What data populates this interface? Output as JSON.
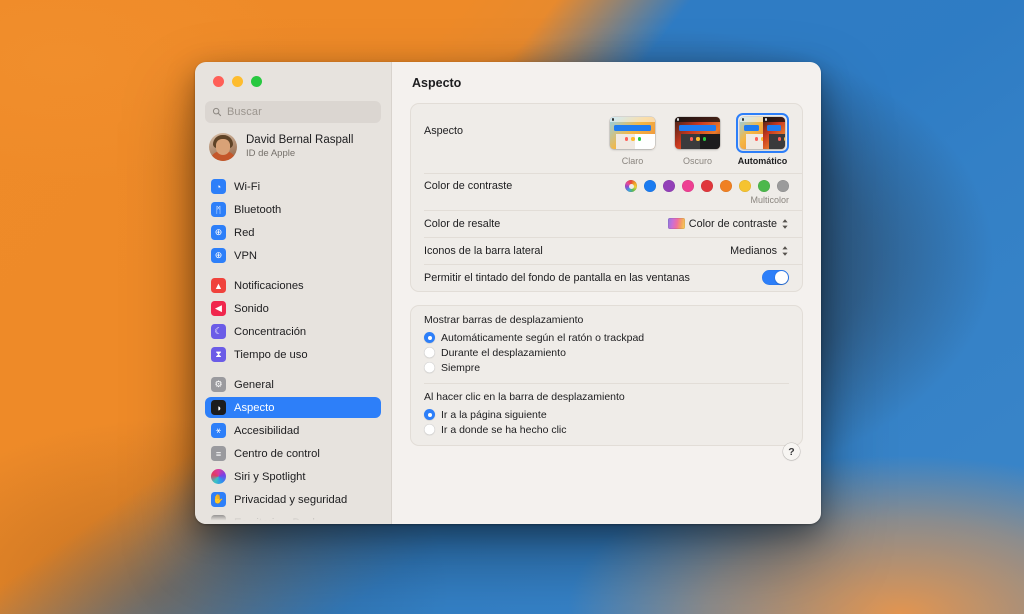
{
  "window": {
    "traffic_lights": [
      {
        "name": "close",
        "color": "#ff5f57"
      },
      {
        "name": "minimize",
        "color": "#febc2e"
      },
      {
        "name": "maximize",
        "color": "#28c840"
      }
    ]
  },
  "sidebar": {
    "search": {
      "placeholder": "Buscar",
      "value": ""
    },
    "profile": {
      "name": "David Bernal Raspall",
      "subtitle": "ID de Apple"
    },
    "groups": [
      {
        "items": [
          {
            "label": "Wi-Fi",
            "icon": "wifi-icon",
            "icon_bg": "#2d7ff9",
            "glyph": "◔",
            "selected": false
          },
          {
            "label": "Bluetooth",
            "icon": "bluetooth-icon",
            "icon_bg": "#2d7ff9",
            "glyph": "ᛗ",
            "selected": false
          },
          {
            "label": "Red",
            "icon": "network-icon",
            "icon_bg": "#2d7ff9",
            "glyph": "⊕",
            "selected": false
          },
          {
            "label": "VPN",
            "icon": "vpn-icon",
            "icon_bg": "#2d7ff9",
            "glyph": "⊕",
            "selected": false
          }
        ]
      },
      {
        "items": [
          {
            "label": "Notificaciones",
            "icon": "bell-icon",
            "icon_bg": "#f0423c",
            "glyph": "▲",
            "selected": false
          },
          {
            "label": "Sonido",
            "icon": "speaker-icon",
            "icon_bg": "#f0274d",
            "glyph": "◀",
            "selected": false
          },
          {
            "label": "Concentración",
            "icon": "moon-icon",
            "icon_bg": "#6b5ce7",
            "glyph": "☾",
            "selected": false
          },
          {
            "label": "Tiempo de uso",
            "icon": "hourglass-icon",
            "icon_bg": "#6b5ce7",
            "glyph": "⧗",
            "selected": false
          }
        ]
      },
      {
        "items": [
          {
            "label": "General",
            "icon": "gear-icon",
            "icon_bg": "#9a9a9e",
            "glyph": "⚙",
            "selected": false
          },
          {
            "label": "Aspecto",
            "icon": "appearance-icon",
            "icon_bg": "#1c1c1e",
            "glyph": "◑",
            "selected": true
          },
          {
            "label": "Accesibilidad",
            "icon": "accessibility-icon",
            "icon_bg": "#2d7ff9",
            "glyph": "⚹",
            "selected": false
          },
          {
            "label": "Centro de control",
            "icon": "control-center-icon",
            "icon_bg": "#9a9a9e",
            "glyph": "≡",
            "selected": false
          },
          {
            "label": "Siri y Spotlight",
            "icon": "siri-icon",
            "icon_bg": "#6b3fd4",
            "glyph": "",
            "selected": false
          },
          {
            "label": "Privacidad y seguridad",
            "icon": "privacy-hand-icon",
            "icon_bg": "#2d7ff9",
            "glyph": "✋",
            "selected": false
          },
          {
            "label": "Escritorio y Dock",
            "icon": "desktop-dock-icon",
            "icon_bg": "#2f2f33",
            "glyph": "▭",
            "selected": false
          }
        ]
      }
    ]
  },
  "main": {
    "title": "Aspecto",
    "appearance": {
      "label": "Aspecto",
      "options": [
        {
          "label": "Claro",
          "mode": "light",
          "selected": false
        },
        {
          "label": "Oscuro",
          "mode": "dark",
          "selected": false
        },
        {
          "label": "Automático",
          "mode": "auto",
          "selected": true
        }
      ]
    },
    "contrast_color": {
      "label": "Color de contraste",
      "caption": "Multicolor",
      "swatches": [
        {
          "name": "multicolor",
          "color": "multicolor",
          "selected": true
        },
        {
          "name": "blue",
          "color": "#1a7bf0"
        },
        {
          "name": "purple",
          "color": "#9340b8"
        },
        {
          "name": "pink",
          "color": "#ee3f92"
        },
        {
          "name": "red",
          "color": "#e0373c"
        },
        {
          "name": "orange",
          "color": "#f08022"
        },
        {
          "name": "yellow",
          "color": "#f5c330"
        },
        {
          "name": "green",
          "color": "#4cb84c"
        },
        {
          "name": "graphite",
          "color": "#9b9b9b"
        }
      ]
    },
    "highlight_color": {
      "label": "Color de resalte",
      "value": "Color de contraste"
    },
    "sidebar_icons": {
      "label": "Iconos de la barra lateral",
      "value": "Medianos"
    },
    "wallpaper_tinting": {
      "label": "Permitir el tintado del fondo de pantalla en las ventanas",
      "enabled": true
    },
    "show_scrollbars": {
      "title": "Mostrar barras de desplazamiento",
      "options": [
        {
          "label": "Automáticamente según el ratón o trackpad",
          "checked": true
        },
        {
          "label": "Durante el desplazamiento",
          "checked": false
        },
        {
          "label": "Siempre",
          "checked": false
        }
      ]
    },
    "scrollbar_click": {
      "title": "Al hacer clic en la barra de desplazamiento",
      "options": [
        {
          "label": "Ir a la página siguiente",
          "checked": true
        },
        {
          "label": "Ir a donde se ha hecho clic",
          "checked": false
        }
      ]
    },
    "help": {
      "label": "?"
    }
  },
  "colors": {
    "accent": "#2d7ff9",
    "sidebar_bg": "#e7e3de",
    "content_bg": "#f4f1ee",
    "card_bg": "#efece8"
  }
}
